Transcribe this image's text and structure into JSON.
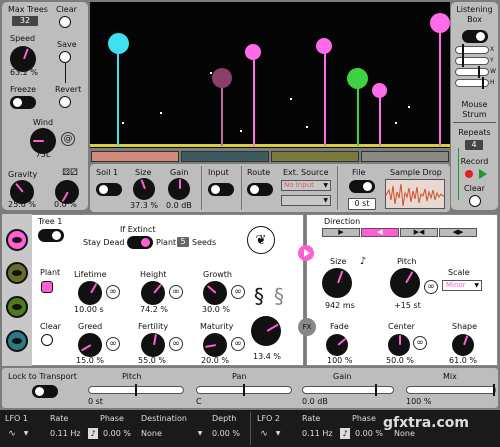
{
  "left_panel": {
    "max_trees_label": "Max Trees",
    "max_trees_value": "32",
    "clear_label": "Clear",
    "speed_label": "Speed",
    "speed_value": "63.2 %",
    "save_label": "Save",
    "freeze_label": "Freeze",
    "revert_label": "Revert",
    "wind_label": "Wind",
    "wind_value": "75L",
    "gravity_label": "Gravity",
    "gravity_value": "25.0 %",
    "dice_value": "0.0 %"
  },
  "right_panel": {
    "listening_box_label": "Listening Box",
    "xywh_labels": [
      "X",
      "Y",
      "W",
      "H"
    ],
    "mouse_strum_label": "Mouse Strum",
    "repeats_label": "Repeats",
    "repeats_value": "4",
    "record_label": "Record",
    "clear_label": "Clear"
  },
  "input_strip": {
    "soil_label": "Soil 1",
    "size_label": "Size",
    "size_value": "37.3 %",
    "gain_label": "Gain",
    "gain_value": "0.0 dB",
    "input_label": "Input",
    "route_label": "Route",
    "ext_source_label": "Ext. Source",
    "ext_source_value": "No Input",
    "file_label": "File",
    "file_value": "0 st",
    "sample_drop_label": "Sample Drop"
  },
  "tree_panel": {
    "tree_label": "Tree 1",
    "if_extinct_label": "If Extinct",
    "stay_dead_label": "Stay Dead",
    "plant_label": "Plant",
    "plant_seeds_value": "5",
    "seeds_label": "Seeds",
    "plant_side_label": "Plant",
    "clear_side_label": "Clear",
    "lifetime_label": "Lifetime",
    "lifetime_value": "10.00 s",
    "height_label": "Height",
    "height_value": "74.2 %",
    "growth_label": "Growth",
    "growth_value": "30.0 %",
    "greed_label": "Greed",
    "greed_value": "15.0 %",
    "fertility_label": "Fertility",
    "fertility_value": "55.0 %",
    "maturity_label": "Maturity",
    "maturity_value": "20.0 %",
    "mutation_value": "13.4 %",
    "fx_label": "FX"
  },
  "direction_panel": {
    "direction_label": "Direction",
    "size_label": "Size",
    "size_value": "942 ms",
    "pitch_label": "Pitch",
    "pitch_value": "+15 st",
    "scale_label": "Scale",
    "scale_value": "Minor",
    "fade_label": "Fade",
    "fade_value": "100 %",
    "center_label": "Center",
    "center_value": "50.0 %",
    "shape_label": "Shape",
    "shape_value": "61.0 %"
  },
  "transport": {
    "lock_label": "Lock to Transport",
    "pitch_label": "Pitch",
    "pitch_value": "0 st",
    "pan_label": "Pan",
    "pan_value": "C",
    "gain_label": "Gain",
    "gain_value": "0.0 dB",
    "mix_label": "Mix",
    "mix_value": "100 %"
  },
  "lfo1": {
    "label": "LFO 1",
    "rate_label": "Rate",
    "rate_value": "0.11 Hz",
    "phase_label": "Phase",
    "phase_value": "0.00 %",
    "destination_label": "Destination",
    "destination_value": "None",
    "depth_label": "Depth",
    "depth_value": "0.00 %"
  },
  "lfo2": {
    "label": "LFO 2",
    "rate_label": "Rate",
    "rate_value": "0.11 Hz",
    "phase_label": "Phase",
    "phase_value": "0.00 %",
    "destination_value": "None"
  },
  "watermark": "gfxtra.com",
  "colors": {
    "accent": "#ff5fd2",
    "tree_cyan": "#3fe0f0",
    "tree_pink": "#ff6be8",
    "tree_mauve": "#c06a9c",
    "tree_green": "#3fd13f",
    "soil_salmon": "#d48a7a",
    "soil_teal": "#3c5a60",
    "soil_olive": "#7a7a3c",
    "soil_grey": "#8c8a86",
    "seed_green": "#4f7a1f",
    "seed_teal": "#2c7a86"
  }
}
